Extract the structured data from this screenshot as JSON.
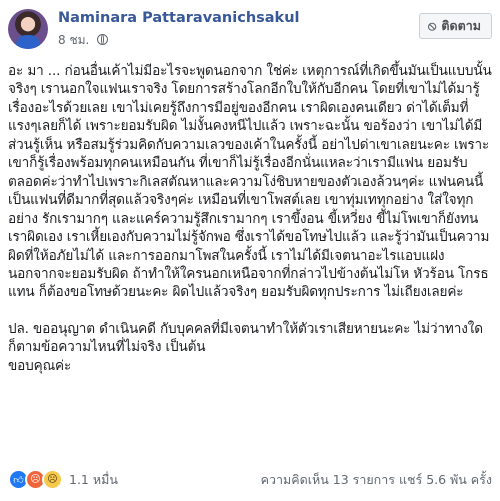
{
  "post": {
    "author": "Naminara Pattaravanichsakul",
    "time": "8 ชม.",
    "follow_label": "ติดตาม",
    "paragraphs": [
      "อะ มา ... ก่อนอื่นเค้าไม่มีอะไรจะพูดนอกจาก ใช่ค่ะ เหตุการณ์ที่เกิดขึ้นมันเป็นแบบนั้นจริงๆ เรานอกใจแฟนเราจริง โดยการสร้างโลกอีกใบให้กับอีกคน โดยที่เขาไม่ได้มารู้เรื่องอะไรด้วยเลย เขาไม่เคยรู้ถึงการมีอยู่ของอีกคน เราผิดเองคนเดียว ด่าได้เต็มที่แรงๆเลยก็ได้ เพราะยอมรับผิด ไม่งั้นคงหนีไปแล้ว เพราะฉะนั้น ขอร้องว่า เขาไม่ได้มีส่วนรู้เห็น หรือสมรู้ร่วมคิดกับความเลวของเค้าในครั้งนี้ อย่าไปด่าเขาเลยนะคะ เพราะเขาก็รู้เรื่องพร้อมทุกคนเหมือนกัน ที่เขาก็ไม่รู้เรื่องอีกนั่นแหละว่าเรามีแฟน ยอมรับตลอดค่ะว่าทำไปเพราะกิเลสตัณหาและความโง่ชิบหายของตัวเองล้วนๆค่ะ แฟนคนนี้เป็นแฟนที่ดีมากที่สุดแล้วจริงๆค่ะ เหมือนที่เขาโพสต์เลย เขาทุ่มเททุกอย่าง ใส่ใจทุกอย่าง รักเรามากๆ และแคร์ความรู้สึกเรามากๆ เราขึ้งอน ขี้เหวี่ยง ขี้ไม่โพเขาก็ยังทน เราผิดเอง เราเหี้ยเองกับความไม่รู้จักพอ ซึ่งเราได้ขอโทษไปแล้ว และรู้ว่ามันเป็นความผิดที่ให้อภัยไม่ได้ และการออกมาโพสในครั้งนี้ เราไม่ได้มีเจตนาอะไรแอบแฝง นอกจากจะยอมรับผิด ถ้าทำให้ใครนอกเหนือจากที่กล่าวไปข้างต้นไม่โห หัวร้อน โกรธแทน ก็ต้องขอโทษด้วยนะคะ ผิดไปแล้วจริงๆ ยอมรับผิดทุกประการ ไม่เถียงเลยค่ะ",
      "ปล. ขออนุญาต ดำเนินคดี กับบุคคลที่มีเจตนาทำให้ตัวเราเสียหายนะคะ ไม่ว่าทางใดก็ตามข้อความไหนที่ไม่จริง เป็นต้น",
      "ขอบคุณค่ะ"
    ]
  },
  "footer": {
    "reaction_count": "1.1 หมื่น",
    "comments": "ความคิดเห็น 13 รายการ",
    "shares": "แชร์ 5.6 พัน ครั้ง"
  },
  "icons": {
    "reactions": [
      "like-icon",
      "angry-icon",
      "sad-icon"
    ],
    "follow": "rss-icon",
    "privacy": "globe-icon"
  },
  "colors": {
    "author_name": "#385898",
    "like": "#2078f4",
    "angry": "#f0643c",
    "sad": "#f7c84b"
  }
}
